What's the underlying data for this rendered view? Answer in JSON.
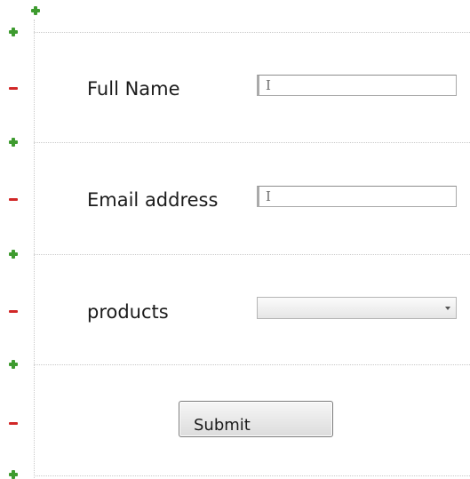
{
  "form": {
    "fields": [
      {
        "label": "Full Name",
        "input_type": "text",
        "value": "",
        "caret_glyph": "I"
      },
      {
        "label": "Email address",
        "input_type": "text",
        "value": "",
        "caret_glyph": "I"
      },
      {
        "label": "products",
        "input_type": "select",
        "selected": ""
      }
    ],
    "submit_label": "Submit"
  },
  "gutter": {
    "add_icon": "plus-icon",
    "remove_icon": "minus-icon",
    "add_color": "#3e9b2f",
    "remove_color": "#d12727"
  }
}
